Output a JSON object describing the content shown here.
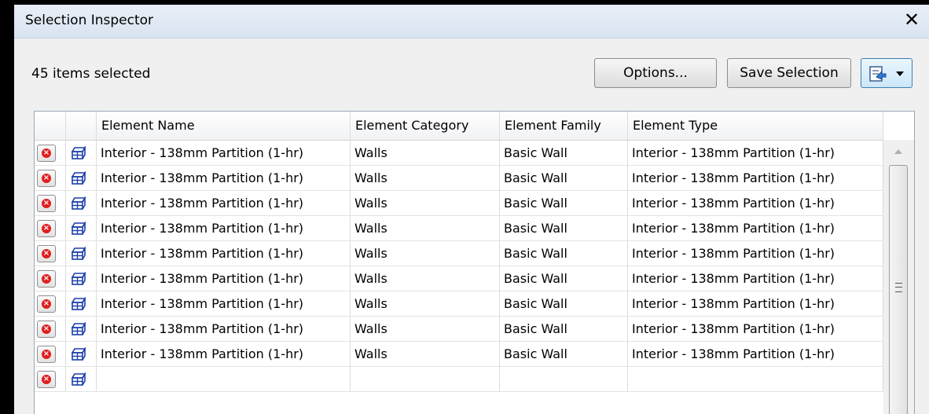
{
  "window": {
    "title": "Selection Inspector",
    "close_symbol": "✕"
  },
  "toolbar": {
    "selection_count": "45 items selected",
    "options_label": "Options...",
    "save_selection_label": "Save Selection",
    "export_icon": "export-icon"
  },
  "table": {
    "columns": [
      "",
      "",
      "Element Name",
      "Element Category",
      "Element Family",
      "Element Type"
    ],
    "rows": [
      {
        "name": "Interior - 138mm Partition (1-hr)",
        "category": "Walls",
        "family": "Basic Wall",
        "type": "Interior - 138mm Partition (1-hr)"
      },
      {
        "name": "Interior - 138mm Partition (1-hr)",
        "category": "Walls",
        "family": "Basic Wall",
        "type": "Interior - 138mm Partition (1-hr)"
      },
      {
        "name": "Interior - 138mm Partition (1-hr)",
        "category": "Walls",
        "family": "Basic Wall",
        "type": "Interior - 138mm Partition (1-hr)"
      },
      {
        "name": "Interior - 138mm Partition (1-hr)",
        "category": "Walls",
        "family": "Basic Wall",
        "type": "Interior - 138mm Partition (1-hr)"
      },
      {
        "name": "Interior - 138mm Partition (1-hr)",
        "category": "Walls",
        "family": "Basic Wall",
        "type": "Interior - 138mm Partition (1-hr)"
      },
      {
        "name": "Interior - 138mm Partition (1-hr)",
        "category": "Walls",
        "family": "Basic Wall",
        "type": "Interior - 138mm Partition (1-hr)"
      },
      {
        "name": "Interior - 138mm Partition (1-hr)",
        "category": "Walls",
        "family": "Basic Wall",
        "type": "Interior - 138mm Partition (1-hr)"
      },
      {
        "name": "Interior - 138mm Partition (1-hr)",
        "category": "Walls",
        "family": "Basic Wall",
        "type": "Interior - 138mm Partition (1-hr)"
      },
      {
        "name": "Interior - 138mm Partition (1-hr)",
        "category": "Walls",
        "family": "Basic Wall",
        "type": "Interior - 138mm Partition (1-hr)"
      },
      {
        "name": "",
        "category": "",
        "family": "",
        "type": ""
      }
    ],
    "row_icons": {
      "remove": "remove-from-selection-icon",
      "element": "wall-element-icon"
    }
  },
  "colors": {
    "remove_icon": "#e01e1e",
    "element_icon": "#1a3fa8",
    "accent_border": "#3c7fb1"
  }
}
